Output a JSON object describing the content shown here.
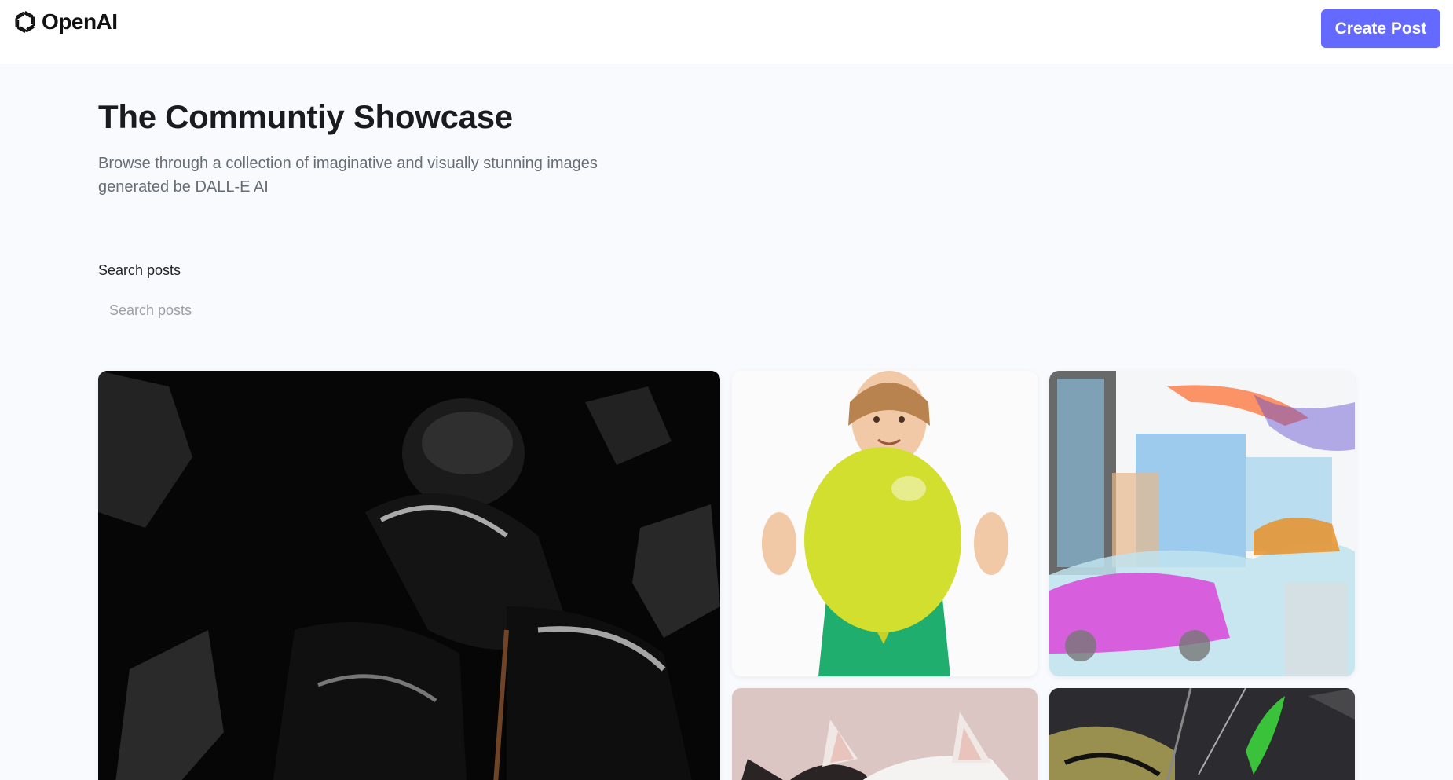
{
  "header": {
    "logo_text": "OpenAI",
    "create_button_label": "Create Post"
  },
  "hero": {
    "title": "The Communtiy Showcase",
    "subtitle": "Browse through a collection of imaginative and visually stunning images generated be DALL-E AI"
  },
  "search": {
    "label": "Search posts",
    "placeholder": "Search posts",
    "value": ""
  },
  "gallery": {
    "posts": [
      {
        "subject": "black-robot-image"
      },
      {
        "subject": "child-with-yellow-balloon-image"
      },
      {
        "subject": "colored-pencil-city-cars-image"
      },
      {
        "subject": "white-cat-image"
      },
      {
        "subject": "dark-fantasy-green-flame-image"
      }
    ]
  },
  "colors": {
    "accent": "#6469ff",
    "page_background": "#f9fafe",
    "header_background": "#ffffff",
    "subtitle_text": "#666e75"
  }
}
